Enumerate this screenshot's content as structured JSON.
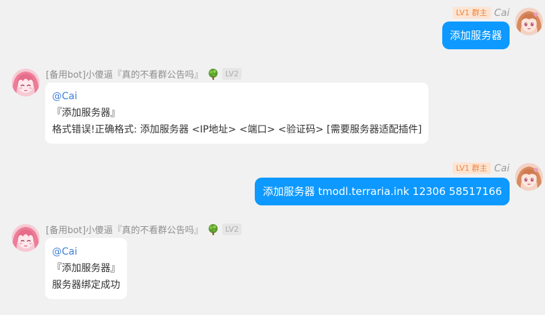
{
  "messages": [
    {
      "side": "self",
      "level_badge": "LV1 群主",
      "sender": "Cai",
      "text": "添加服务器"
    },
    {
      "side": "bot",
      "sender": "[备用bot]小傻逼『真的不看群公告吗』",
      "level_badge": "LV2",
      "lines": [
        "@Cai",
        "『添加服务器』",
        "格式错误!正确格式: 添加服务器 <IP地址> <端口> <验证码> [需要服务器适配插件]"
      ]
    },
    {
      "side": "self",
      "level_badge": "LV1 群主",
      "sender": "Cai",
      "text": "添加服务器 tmodl.terraria.ink 12306 58517166"
    },
    {
      "side": "bot",
      "sender": "[备用bot]小傻逼『真的不看群公告吗』",
      "level_badge": "LV2",
      "lines": [
        "@Cai",
        "『添加服务器』",
        "服务器绑定成功"
      ]
    }
  ],
  "colors": {
    "background": "#f1f1f2",
    "self_bubble": "#0d99ff",
    "bot_bubble": "#ffffff",
    "mention": "#3e7fd9",
    "owner_badge_bg": "#fde4d3",
    "owner_badge_text": "#f0843b"
  },
  "icons": {
    "self_avatar": "anime-girl-avatar-icon",
    "bot_avatar": "pink-hair-anime-avatar-icon",
    "level_tree": "tree-level-icon"
  }
}
